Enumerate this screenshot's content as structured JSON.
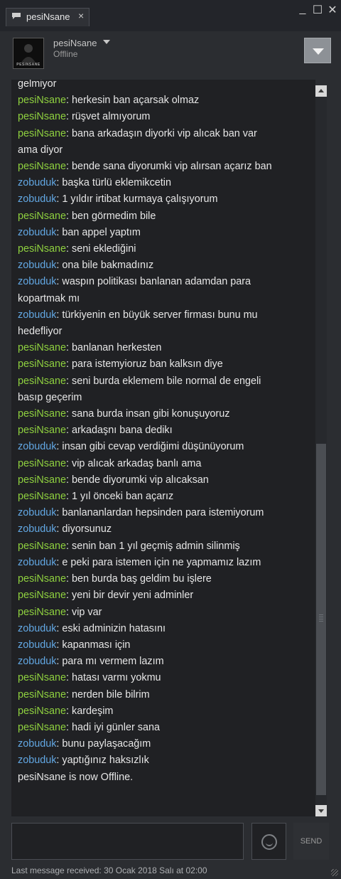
{
  "tab": {
    "title": "pesiNsane",
    "close": "×"
  },
  "window": {
    "minimize": "_",
    "maximize": "☐",
    "close": "✕"
  },
  "header": {
    "username": "pesiNsane",
    "status": "Offline",
    "avatar_text": "PESINSANE"
  },
  "messages": [
    {
      "sender": "",
      "text": "gelmiyor"
    },
    {
      "sender": "pesiNsane",
      "text": "herkesin ban açarsak olmaz"
    },
    {
      "sender": "pesiNsane",
      "text": "rüşvet almıyorum"
    },
    {
      "sender": "pesiNsane",
      "text": "bana arkadaşın diyorki vip alıcak ban var"
    },
    {
      "sender": "",
      "text": "ama diyor"
    },
    {
      "sender": "pesiNsane",
      "text": "bende sana diyorumki vip alırsan açarız ban"
    },
    {
      "sender": "zobuduk",
      "text": "başka türlü eklemikcetin"
    },
    {
      "sender": "zobuduk",
      "text": "1 yıldır irtibat kurmaya çalışıyorum"
    },
    {
      "sender": "pesiNsane",
      "text": "ben görmedim bile"
    },
    {
      "sender": "zobuduk",
      "text": "ban appel yaptım"
    },
    {
      "sender": "pesiNsane",
      "text": "seni eklediğini"
    },
    {
      "sender": "zobuduk",
      "text": "ona bile bakmadınız"
    },
    {
      "sender": "zobuduk",
      "text": "waspın politikası banlanan adamdan para"
    },
    {
      "sender": "",
      "text": "kopartmak mı"
    },
    {
      "sender": "zobuduk",
      "text": "türkiyenin en büyük server firması bunu mu"
    },
    {
      "sender": "",
      "text": "hedefliyor"
    },
    {
      "sender": "pesiNsane",
      "text": "banlanan herkesten"
    },
    {
      "sender": "pesiNsane",
      "text": "para istemyioruz ban kalksın diye"
    },
    {
      "sender": "pesiNsane",
      "text": "seni burda eklemem bile normal de engeli"
    },
    {
      "sender": "",
      "text": "basıp geçerim"
    },
    {
      "sender": "pesiNsane",
      "text": "sana burda insan gibi  konuşuyoruz"
    },
    {
      "sender": "pesiNsane",
      "text": "arkadaşnı bana dedikı"
    },
    {
      "sender": "zobuduk",
      "text": "insan gibi cevap verdiğimi düşünüyorum"
    },
    {
      "sender": "pesiNsane",
      "text": "vip alıcak arkadaş banlı ama"
    },
    {
      "sender": "pesiNsane",
      "text": "bende diyorumki vip alıcaksan"
    },
    {
      "sender": "pesiNsane",
      "text": "1 yıl önceki ban açarız"
    },
    {
      "sender": "zobuduk",
      "text": "banlananlardan hepsinden para istemiyorum"
    },
    {
      "sender": "zobuduk",
      "text": "diyorsunuz"
    },
    {
      "sender": "pesiNsane",
      "text": "senin ban 1 yıl geçmiş admin silinmiş"
    },
    {
      "sender": "zobuduk",
      "text": "e peki para istemen  için ne yapmamız lazım"
    },
    {
      "sender": "pesiNsane",
      "text": "ben burda baş geldim bu işlere"
    },
    {
      "sender": "pesiNsane",
      "text": "yeni bir devir yeni adminler"
    },
    {
      "sender": "pesiNsane",
      "text": "vip var"
    },
    {
      "sender": "zobuduk",
      "text": "eski adminizin hatasını"
    },
    {
      "sender": "zobuduk",
      "text": "kapanması için"
    },
    {
      "sender": "zobuduk",
      "text": "para mı vermem lazım"
    },
    {
      "sender": "pesiNsane",
      "text": "hatası varmı yokmu"
    },
    {
      "sender": "pesiNsane",
      "text": "nerden bile bilrim"
    },
    {
      "sender": "pesiNsane",
      "text": "kardeşim"
    },
    {
      "sender": "pesiNsane",
      "text": "hadi iyi günler sana"
    },
    {
      "sender": "zobuduk",
      "text": "bunu paylaşacağım"
    },
    {
      "sender": "zobuduk",
      "text": "yaptığınız haksızlık"
    },
    {
      "sender": "",
      "text": "pesiNsane is now Offline."
    }
  ],
  "composer": {
    "send_label": "SEND"
  },
  "footer": {
    "text": "Last message received: 30 Ocak 2018 Salı at 02:00"
  },
  "colors": {
    "self": "#8fd13f",
    "other": "#62a7e3",
    "background": "#202124"
  },
  "icons": [
    "chat-icon",
    "close-icon",
    "minimize-icon",
    "maximize-icon",
    "dropdown-icon",
    "emoji-icon"
  ]
}
